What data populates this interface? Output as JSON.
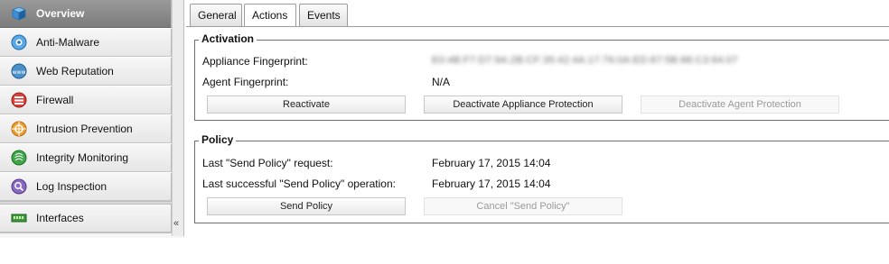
{
  "sidebar": {
    "items": [
      {
        "label": "Overview",
        "icon": "overview-icon"
      },
      {
        "label": "Anti-Malware",
        "icon": "anti-malware-icon"
      },
      {
        "label": "Web Reputation",
        "icon": "web-reputation-icon"
      },
      {
        "label": "Firewall",
        "icon": "firewall-icon"
      },
      {
        "label": "Intrusion Prevention",
        "icon": "intrusion-prevention-icon"
      },
      {
        "label": "Integrity Monitoring",
        "icon": "integrity-monitoring-icon"
      },
      {
        "label": "Log Inspection",
        "icon": "log-inspection-icon"
      },
      {
        "label": "Interfaces",
        "icon": "interfaces-icon"
      }
    ],
    "selected": "Overview",
    "collapse_label": "«"
  },
  "tabs": [
    {
      "label": "General"
    },
    {
      "label": "Actions"
    },
    {
      "label": "Events"
    }
  ],
  "active_tab": "Actions",
  "activation": {
    "title": "Activation",
    "appliance_fingerprint_label": "Appliance Fingerprint:",
    "appliance_fingerprint_value": "E0:4B:F7:D7:9A:2B:CF:35:42:4A:17:76:0A:ED:87:5B:88:C3:84:07",
    "agent_fingerprint_label": "Agent Fingerprint:",
    "agent_fingerprint_value": "N/A",
    "reactivate_label": "Reactivate",
    "deactivate_appliance_label": "Deactivate Appliance Protection",
    "deactivate_agent_label": "Deactivate Agent Protection"
  },
  "policy": {
    "title": "Policy",
    "last_request_label": "Last \"Send Policy\" request:",
    "last_request_value": "February 17, 2015 14:04",
    "last_success_label": "Last successful \"Send Policy\" operation:",
    "last_success_value": "February 17, 2015 14:04",
    "send_policy_label": "Send Policy",
    "cancel_send_policy_label": "Cancel \"Send Policy\""
  }
}
